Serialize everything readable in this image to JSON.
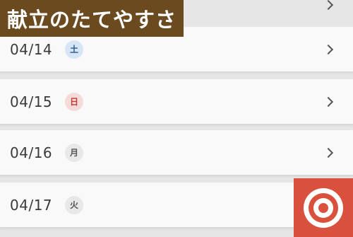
{
  "overlay": {
    "title": "献立のたてやすさ"
  },
  "days": [
    {
      "date": "04/14",
      "weekday": "土",
      "kind": "sat"
    },
    {
      "date": "04/15",
      "weekday": "日",
      "kind": "sun"
    },
    {
      "date": "04/16",
      "weekday": "月",
      "kind": "weekday"
    },
    {
      "date": "04/17",
      "weekday": "火",
      "kind": "weekday"
    }
  ],
  "colors": {
    "title_bg": "#6b4a1f",
    "logo_bg": "#d9513c",
    "saturday": "#2c5a8a",
    "sunday": "#c0393b"
  },
  "icons": {
    "row_arrow": "chevron-right-icon",
    "logo": "target-logo-icon"
  }
}
